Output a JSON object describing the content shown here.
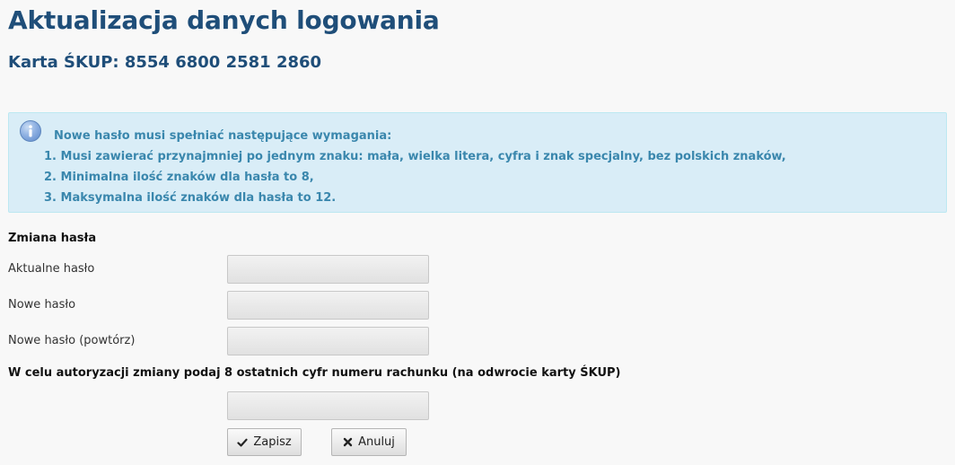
{
  "page": {
    "title": "Aktualizacja danych logowania",
    "card_line": "Karta ŚKUP: 8554 6800 2581 2860"
  },
  "info": {
    "icon": "info-icon",
    "heading": "Nowe hasło musi spełniać następujące wymagania:",
    "rules": [
      "1. Musi zawierać przynajmniej po jednym znaku: mała, wielka litera, cyfra i znak specjalny, bez polskich znaków,",
      "2. Minimalna ilość znaków dla hasła to 8,",
      "3. Maksymalna ilość znaków dla hasła to 12."
    ],
    "colors": {
      "background": "#d9edf7",
      "border": "#bce8f1",
      "text": "#3a87ad"
    }
  },
  "form": {
    "section_title": "Zmiana hasła",
    "fields": {
      "current_password": {
        "label": "Aktualne hasło",
        "value": "",
        "placeholder": ""
      },
      "new_password": {
        "label": "Nowe hasło",
        "value": "",
        "placeholder": ""
      },
      "repeat_password": {
        "label": "Nowe hasło (powtórz)",
        "value": "",
        "placeholder": ""
      }
    },
    "auth": {
      "label": "W celu autoryzacji zmiany podaj 8 ostatnich cyfr numeru rachunku (na odwrocie karty ŚKUP)",
      "value": "",
      "placeholder": ""
    },
    "buttons": {
      "save": {
        "label": "Zapisz",
        "icon": "checkmark-icon"
      },
      "cancel": {
        "label": "Anuluj",
        "icon": "close-icon"
      }
    }
  },
  "colors": {
    "title": "#1f4e79",
    "page_background": "#f8f8f8"
  }
}
